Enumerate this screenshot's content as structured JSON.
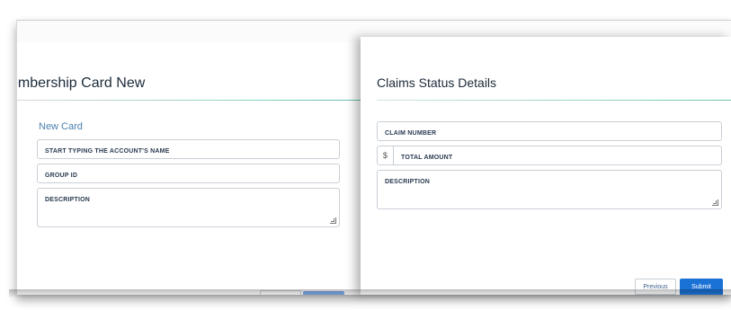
{
  "left_form": {
    "title": "embership Card New",
    "section_label": "New Card",
    "fields": {
      "account": {
        "label": "START TYPING THE ACCOUNT'S NAME"
      },
      "group_id": {
        "label": "GROUP ID"
      },
      "description": {
        "label": "DESCRIPTION"
      }
    }
  },
  "right_form": {
    "title": "Claims Status Details",
    "fields": {
      "claim_number": {
        "label": "CLAIM NUMBER"
      },
      "total_amount": {
        "label": "TOTAL AMOUNT",
        "prefix": "$"
      },
      "description": {
        "label": "DESCRIPTION"
      }
    },
    "buttons": {
      "previous": "Previous",
      "submit": "Submit"
    }
  },
  "colors": {
    "accent": "#1b72d6",
    "rule_teal": "#62c1ad",
    "section_label": "#4a7fb0"
  }
}
